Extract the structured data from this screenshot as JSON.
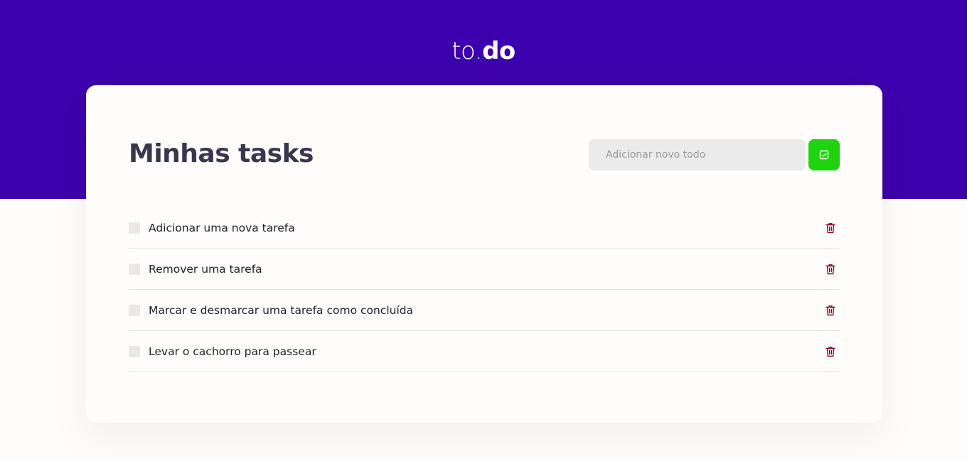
{
  "header": {
    "logo_light": "to.",
    "logo_bold": "do",
    "background_color": "#3d00ad"
  },
  "main": {
    "title": "Minhas tasks",
    "new_task_input": {
      "placeholder": "Adicionar novo todo",
      "value": ""
    },
    "add_button": {
      "icon": "check-square-icon",
      "color": "#1fd30e"
    },
    "tasks": [
      {
        "label": "Adicionar uma nova tarefa",
        "done": false
      },
      {
        "label": "Remover uma tarefa",
        "done": false
      },
      {
        "label": "Marcar e desmarcar uma tarefa como concluída",
        "done": false
      },
      {
        "label": "Levar o cachorro para passear",
        "done": false
      }
    ],
    "delete_icon": "trash-icon",
    "delete_color": "#8a0039"
  }
}
